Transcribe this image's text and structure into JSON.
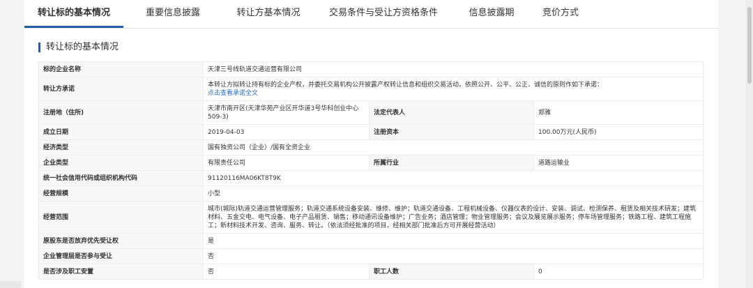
{
  "tabs": [
    {
      "label": "转让标的基本情况",
      "active": true
    },
    {
      "label": "重要信息披露",
      "active": false
    },
    {
      "label": "转让方基本情况",
      "active": false
    },
    {
      "label": "交易条件与受让方资格条件",
      "active": false
    },
    {
      "label": "信息披露期",
      "active": false
    },
    {
      "label": "竞价方式",
      "active": false
    }
  ],
  "section_title": "转让标的基本情况",
  "fields": {
    "company_name": {
      "label": "标的企业名称",
      "value": "天津三号线轨道交通运营有限公司"
    },
    "commitment": {
      "label": "转让方承诺",
      "value": "本转让方拟转让持有标的企业产权，并委托交易机构公开披露产权转让信息和组织交易活动。依照公开、公平、公正、诚信的原则作如下承诺：",
      "link": "点击查看承诺全文"
    },
    "address": {
      "label": "注册地（住所)",
      "value": "天津市南开区(天津华苑产业区开华道3号华科创业中心509-3)"
    },
    "legal_rep": {
      "label": "法定代表人",
      "value": "郑雅"
    },
    "established": {
      "label": "成立日期",
      "value": "2019-04-03"
    },
    "capital": {
      "label": "注册资本",
      "value": "100.00万元(人民币)"
    },
    "economy_type": {
      "label": "经济类型",
      "value": "国有独资公司（企业）/国有全资企业"
    },
    "company_type": {
      "label": "企业类型",
      "value": "有限责任公司"
    },
    "industry": {
      "label": "所属行业",
      "value": "道路运输业"
    },
    "credit_code": {
      "label": "统一社会信用代码或组织机构代码",
      "value": "91120116MA06KT8T9K"
    },
    "scale": {
      "label": "经营规模",
      "value": "小型"
    },
    "scope": {
      "label": "经营范围",
      "value": "城市(城际)轨道交通运营管理服务；轨道交通系统设备安装、维修、维护；轨道交通设备、工程机械设备、仪器仪表的设计、安装、调试、检测保养、租赁及相关技术研发；建筑材料、五金交电、电气设备、电子产品租赁、销售；移动通讯设备维护；广告业务；酒店管理；物业管理服务；会议及展览展示服务；停车场管理服务；铁路工程、建筑工程施工；新材料技术开发、咨询、服务、转让。（依法须经批准的项目，经相关部门批准后方可开展经营活动）"
    },
    "preemptive": {
      "label": "原股东是否放弃优先受让权",
      "value": "是"
    },
    "mgmt_participate": {
      "label": "企业管理层是否参与受让",
      "value": "否"
    },
    "staff_placement": {
      "label": "是否涉及职工安置",
      "value": "否"
    },
    "staff_count": {
      "label": "职工人数",
      "value": "0"
    }
  }
}
